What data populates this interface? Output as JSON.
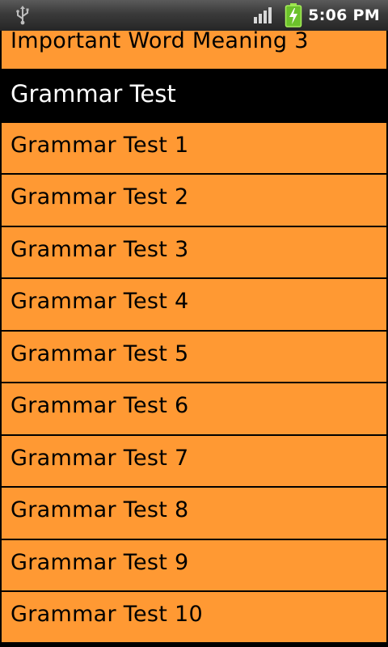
{
  "status_bar": {
    "time": "5:06 PM",
    "icons": [
      "usb-icon",
      "signal-icon",
      "battery-charging-icon"
    ],
    "battery_color": "#7ed321"
  },
  "list": {
    "row_color": "#ff9933",
    "header_color": "#000000",
    "partial_item": "Important Word Meaning 3",
    "section_header": "Grammar Test",
    "items": [
      "Grammar Test 1",
      "Grammar Test 2",
      "Grammar Test 3",
      "Grammar Test 4",
      "Grammar Test 5",
      "Grammar Test 6",
      "Grammar Test 7",
      "Grammar Test 8",
      "Grammar Test 9",
      "Grammar Test 10"
    ]
  }
}
